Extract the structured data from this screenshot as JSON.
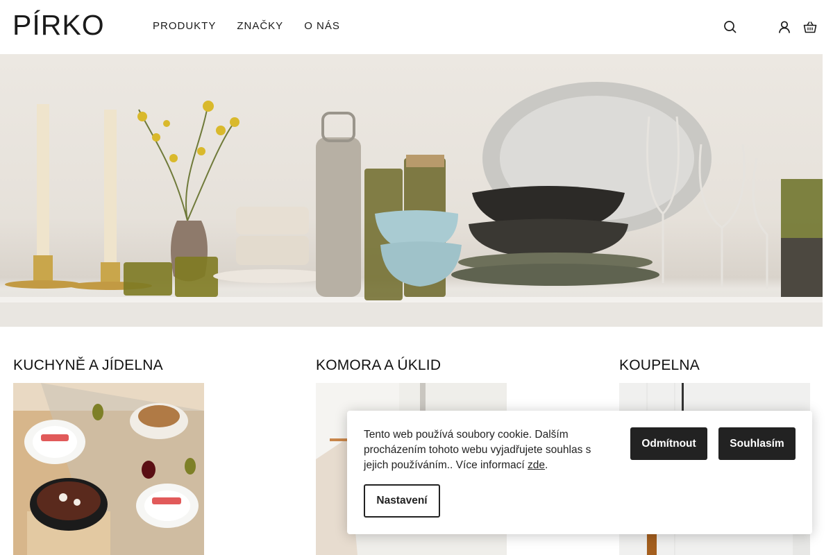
{
  "header": {
    "logo_text": "PÍRKO",
    "nav": [
      {
        "label": "PRODUKTY"
      },
      {
        "label": "ZNAČKY"
      },
      {
        "label": "O NÁS"
      }
    ],
    "icons": [
      "search-icon",
      "user-icon",
      "basket-icon"
    ]
  },
  "categories": [
    {
      "title": "KUCHYNĚ A JÍDELNA"
    },
    {
      "title": "KOMORA A ÚKLID"
    },
    {
      "title": "KOUPELNA"
    }
  ],
  "cookie": {
    "text": "Tento web používá soubory cookie. Dalším procházením tohoto webu vyjadřujete souhlas s jejich používáním.. Více informací ",
    "link_label": "zde",
    "text_end": ".",
    "decline_label": "Odmítnout",
    "accept_label": "Souhlasím",
    "settings_label": "Nastavení"
  },
  "colors": {
    "text": "#1a1a1a",
    "button_dark": "#222222",
    "hero_bg": "#e6e1da"
  }
}
